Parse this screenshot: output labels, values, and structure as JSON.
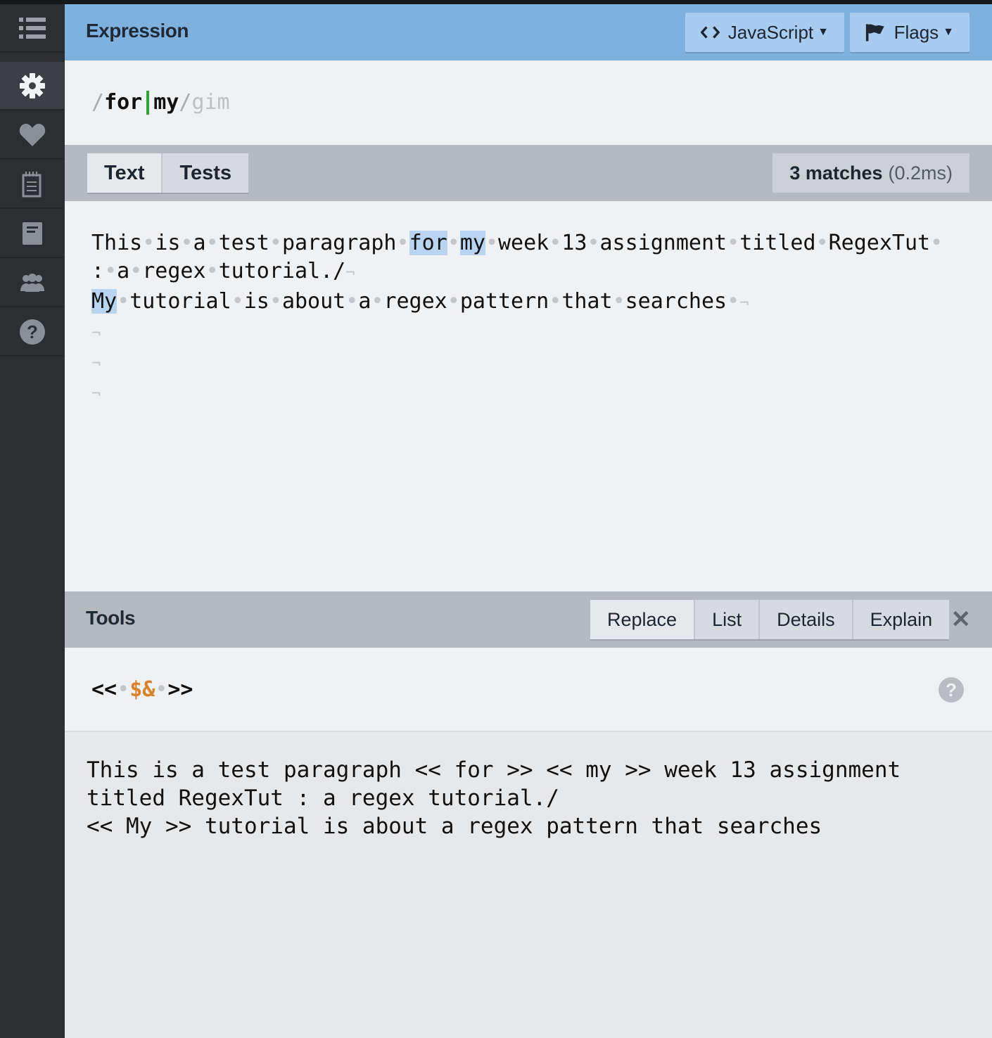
{
  "sidebar": {
    "items": [
      {
        "name": "menu",
        "icon": "list-icon"
      },
      {
        "name": "settings",
        "icon": "gear-icon"
      },
      {
        "name": "favorites",
        "icon": "heart-icon"
      },
      {
        "name": "cheatsheet",
        "icon": "notepad-icon"
      },
      {
        "name": "reference",
        "icon": "book-icon"
      },
      {
        "name": "community",
        "icon": "users-icon"
      },
      {
        "name": "help",
        "icon": "question-icon"
      }
    ]
  },
  "expression": {
    "title": "Expression",
    "language_button": "JavaScript",
    "flags_button": "Flags",
    "open_slash": "/",
    "token_1": "for",
    "token_2": "my",
    "close_slash": "/",
    "flags": "gim"
  },
  "text_panel": {
    "tabs": [
      "Text",
      "Tests"
    ],
    "matches_count": "3 matches",
    "matches_time": "(0.2ms)",
    "source_lines": [
      [
        "This",
        "is",
        "a",
        "test",
        "paragraph",
        "for",
        "my",
        "week",
        "13",
        "assignment",
        "titled",
        "RegexTut"
      ],
      [
        ":",
        "a",
        "regex",
        "tutorial./"
      ],
      [
        "My",
        "tutorial",
        "is",
        "about",
        "a",
        "regex",
        "pattern",
        "that",
        "searches"
      ]
    ]
  },
  "tools": {
    "title": "Tools",
    "tabs": [
      "Replace",
      "List",
      "Details",
      "Explain"
    ],
    "close": "✕",
    "replace_open": "<<",
    "replace_token": "$&",
    "replace_close": ">>",
    "help": "?",
    "result_lines": [
      "This is a test paragraph << for >> << my >> week 13 assignment",
      "titled RegexTut : a regex tutorial./",
      "<< My >> tutorial is about a regex pattern that searches"
    ]
  },
  "colors": {
    "header_blue": "#7fb1df",
    "match_highlight": "#b8d4f0",
    "alternation_green": "#2ea52e",
    "replace_token_orange": "#d9822b"
  }
}
